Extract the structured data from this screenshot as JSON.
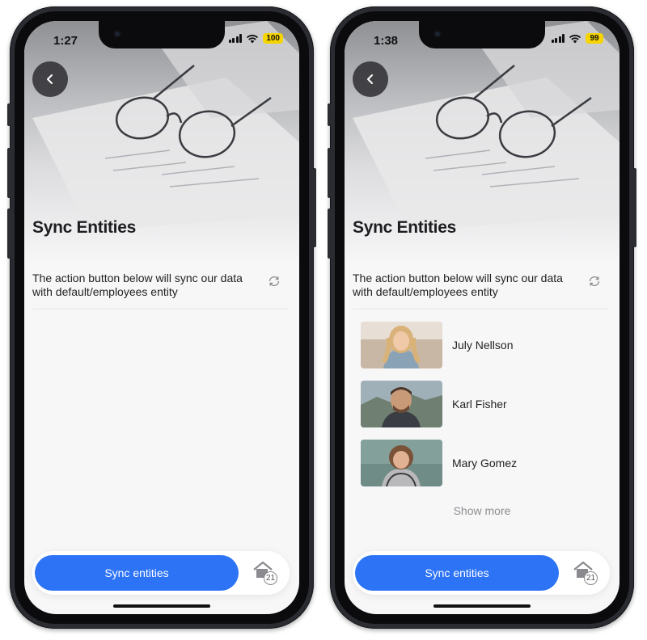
{
  "screens": [
    {
      "status": {
        "time": "1:27",
        "battery": "100"
      },
      "title": "Sync Entities",
      "description": "The action button below will sync our data with default/employees entity",
      "entities": [],
      "show_more": "",
      "sync_button": "Sync entities",
      "home_badge": "21"
    },
    {
      "status": {
        "time": "1:38",
        "battery": "99"
      },
      "title": "Sync Entities",
      "description": "The action button below will sync our data with default/employees entity",
      "entities": [
        {
          "name": "July Nellson"
        },
        {
          "name": "Karl Fisher"
        },
        {
          "name": "Mary Gomez"
        }
      ],
      "show_more": "Show more",
      "sync_button": "Sync entities",
      "home_badge": "21"
    }
  ],
  "icons": {
    "back": "chevron-left-icon",
    "sync": "sync-icon",
    "home": "home-icon",
    "signal": "cellular-signal-icon",
    "wifi": "wifi-icon"
  },
  "colors": {
    "accent": "#2d73f5",
    "battery": "#f5d400",
    "muted_text": "#8e8e93"
  }
}
